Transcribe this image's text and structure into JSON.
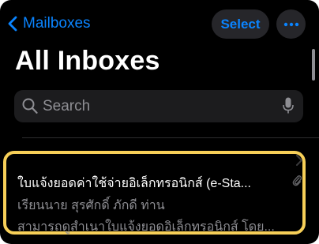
{
  "nav": {
    "back_label": "Mailboxes",
    "select_label": "Select"
  },
  "header": {
    "title": "All Inboxes"
  },
  "search": {
    "placeholder": "Search"
  },
  "messages": [
    {
      "subject": "ใบแจ้งยอดค่าใช้จ่ายอิเล็กทรอนิกส์ (e-Sta...",
      "preview_line_1": "เรียนนาย สุรศักดิ์ ภักดี ท่าน",
      "preview_line_2": "สามารถดูสำเนาใบแจ้งยอดอิเล็กทรอนิกส์ โดย...",
      "has_attachment": true,
      "highlighted": true
    }
  ],
  "colors": {
    "background": "#000000",
    "accent": "#0a84ff",
    "highlight_border": "#f7cf58",
    "secondary_text": "#8e8e93",
    "control_fill": "#26262a",
    "search_fill": "#1c1c1e"
  },
  "icons": {
    "back": "chevron-left-icon",
    "more": "ellipsis-icon",
    "search": "search-icon",
    "dictation": "mic-icon",
    "attachment": "paperclip-icon",
    "disclosure": "chevron-right-icon"
  }
}
